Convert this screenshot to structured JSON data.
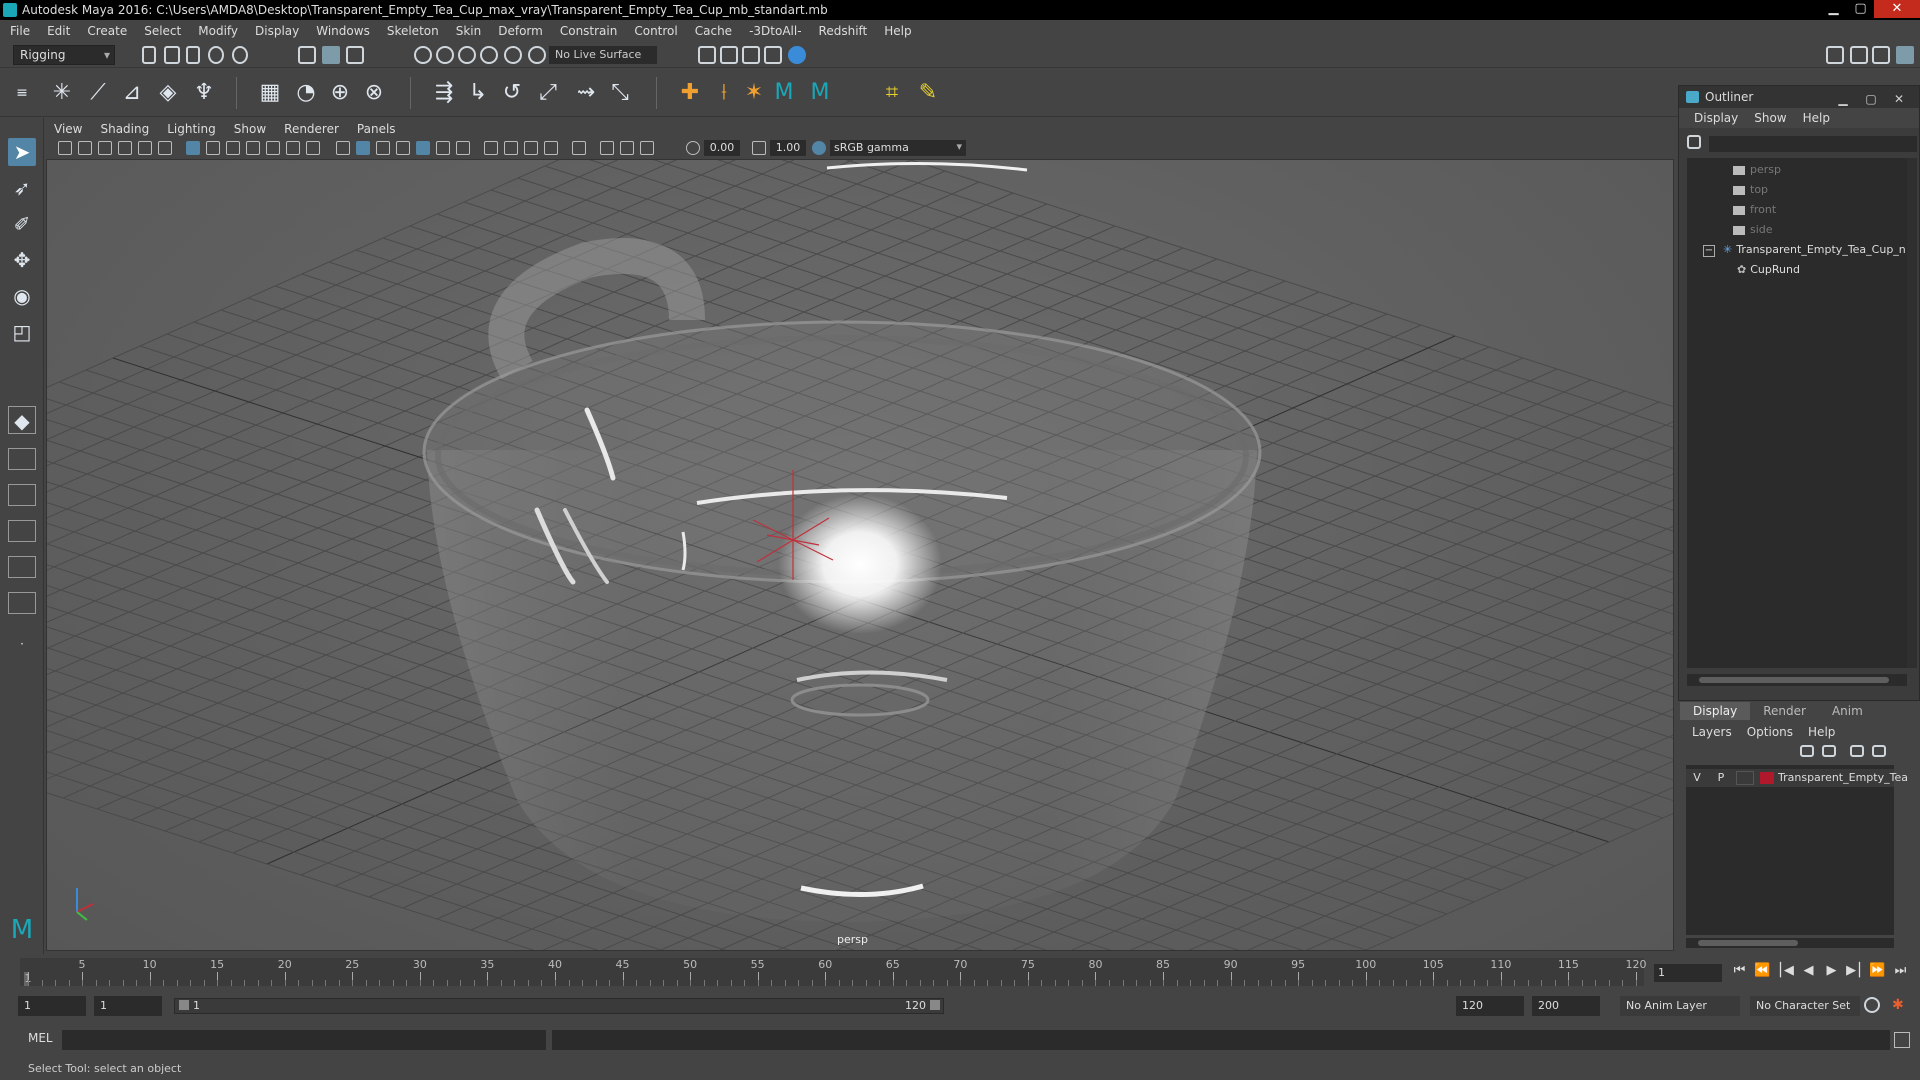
{
  "window": {
    "title": "Autodesk Maya 2016: C:\\Users\\AMDA8\\Desktop\\Transparent_Empty_Tea_Cup_max_vray\\Transparent_Empty_Tea_Cup_mb_standart.mb",
    "minimize": "▁",
    "maximize": "▢",
    "close": "✕"
  },
  "menubar": [
    "File",
    "Edit",
    "Create",
    "Select",
    "Modify",
    "Display",
    "Windows",
    "Skeleton",
    "Skin",
    "Deform",
    "Constrain",
    "Control",
    "Cache",
    "-3DtoAll-",
    "Redshift",
    "Help"
  ],
  "statusline": {
    "mode": "Rigging",
    "live_surface": "No Live Surface"
  },
  "viewport": {
    "menu": [
      "View",
      "Shading",
      "Lighting",
      "Show",
      "Renderer",
      "Panels"
    ],
    "exposure": "0.00",
    "gamma": "1.00",
    "color_space": "sRGB gamma",
    "camera_label": "persp",
    "axis_y": "y",
    "axis_x": "x"
  },
  "outliner": {
    "title": "Outliner",
    "menu": [
      "Display",
      "Show",
      "Help"
    ],
    "items": [
      {
        "label": "persp"
      },
      {
        "label": "top"
      },
      {
        "label": "front"
      },
      {
        "label": "side"
      },
      {
        "label": "Transparent_Empty_Tea_Cup_n"
      },
      {
        "label": "CupRund"
      }
    ]
  },
  "layer_editor": {
    "tabs": [
      "Display",
      "Render",
      "Anim"
    ],
    "menu": [
      "Layers",
      "Options",
      "Help"
    ],
    "layer": {
      "v": "V",
      "p": "P",
      "name": "Transparent_Empty_Tea"
    }
  },
  "timeline": {
    "ticks": [
      "1",
      "5",
      "10",
      "15",
      "20",
      "25",
      "30",
      "35",
      "40",
      "45",
      "50",
      "55",
      "60",
      "65",
      "70",
      "75",
      "80",
      "85",
      "90",
      "95",
      "100",
      "105",
      "110",
      "115",
      "120"
    ],
    "current_frame": "1",
    "controls": [
      "⏮",
      "⏭|",
      "|◀",
      "◀",
      "▶",
      "▶|",
      "⏭",
      "⏭"
    ]
  },
  "range": {
    "start": "1",
    "playback_start": "1",
    "slider_start": "1",
    "slider_end": "120",
    "playback_end": "120",
    "end": "200",
    "anim_layer": "No Anim Layer",
    "character_set": "No Character Set"
  },
  "command": {
    "label": "MEL"
  },
  "help_line": "Select Tool: select an object"
}
